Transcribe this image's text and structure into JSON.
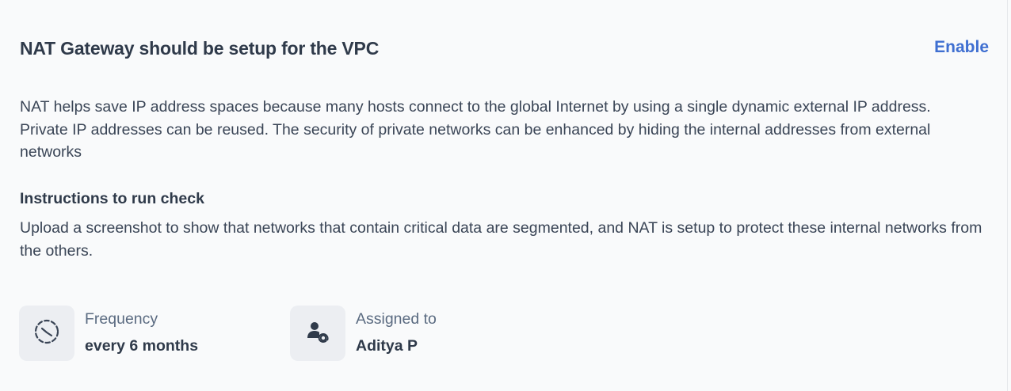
{
  "check": {
    "title": "NAT Gateway should be setup for the VPC",
    "action_label": "Enable",
    "description": "NAT helps save IP address spaces because many hosts connect to the global Internet by using a single dynamic external IP address. Private IP addresses can be reused. The security of private networks can be enhanced by hiding the internal addresses from external networks",
    "instructions_heading": "Instructions to run check",
    "instructions_text": "Upload a screenshot to show that networks that contain critical data are segmented, and NAT is setup to protect these internal networks from the others."
  },
  "meta": {
    "frequency": {
      "label": "Frequency",
      "value": "every 6 months",
      "icon": "recurring-clock-icon"
    },
    "assigned": {
      "label": "Assigned to",
      "value": "Aditya P",
      "icon": "user-at-icon"
    }
  },
  "colors": {
    "accent": "#3f6fd1",
    "text": "#2f3a4a",
    "muted": "#5b6b81",
    "icon_bg": "#eceef2",
    "background": "#f9fafb"
  }
}
